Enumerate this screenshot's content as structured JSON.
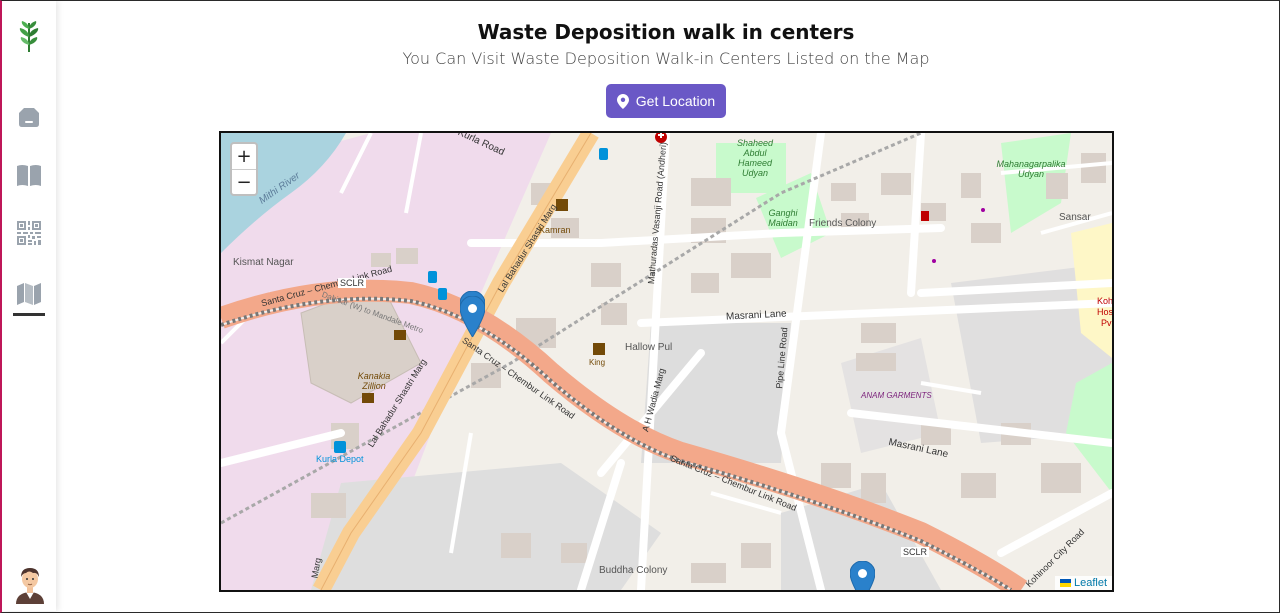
{
  "page": {
    "title": "Waste Deposition walk in centers",
    "subtitle": "You Can Visit Waste Deposition Walk-in Centers Listed on the Map",
    "get_location_label": "Get Location"
  },
  "sidebar": {
    "items": [
      {
        "name": "logo",
        "icon": "leaf-logo-icon"
      },
      {
        "name": "dashboard",
        "icon": "dashboard-icon"
      },
      {
        "name": "guide",
        "icon": "book-icon"
      },
      {
        "name": "qr-scan",
        "icon": "qr-code-icon"
      },
      {
        "name": "map",
        "icon": "map-icon",
        "active": true
      }
    ],
    "avatar": "user-avatar"
  },
  "map": {
    "zoom_in": "+",
    "zoom_out": "−",
    "attribution": "Leaflet",
    "labels": {
      "kurla_road": "Kurla Road",
      "mithi_river": "Mithi River",
      "kismat_nagar": "Kismat Nagar",
      "link_road_1": "Santa Cruz – Chembur Link Road",
      "link_road_2": "Santa Cruz – Chembur Link Road",
      "link_road_3": "Santa Cruz – Chembur Link Road",
      "sclr_1": "SCLR",
      "sclr_2": "SCLR",
      "dahisar": "Dahisar (W) to Mandale Metro",
      "lbs_marg_1": "Lal Bahadur Shastri Marg",
      "lbs_marg_2": "Lal Bahadur Shastri Marg",
      "lbs_marg_3": "Marg",
      "kamran": "Kamran",
      "kanakia": "Kanakia Zillion",
      "kurla_depot": "Kurla Depot",
      "shaheed_park": "Shaheed Abdul Hameed Udyan",
      "ganghi_maidan": "Ganghi Maidan",
      "friends_colony": "Friends Colony",
      "mahanagar": "Mahanagarpalika Udyan",
      "sansar": "Sansar",
      "mathuradas": "Mathuradas Vasanji Road (Andheri)",
      "masrani_lane_1": "Masrani Lane",
      "masrani_lane_2": "Masrani Lane",
      "hallow_pul": "Hallow Pul",
      "king": "King",
      "ah_wadia": "A H Wadia Marg",
      "pipe_line": "Pipe Line Road",
      "anam": "ANAM GARMENTS",
      "kohinoor": "Kohinoor City Road",
      "buddha": "Buddha Colony",
      "hospital_1": "Koh",
      "hospital_2": "Hos",
      "hospital_3": "Pv"
    },
    "markers": [
      {
        "name": "walk-in-center-marker-1"
      },
      {
        "name": "walk-in-center-marker-2"
      },
      {
        "name": "walk-in-center-marker-3"
      }
    ]
  },
  "colors": {
    "accent": "#6a58c6",
    "marker": "#2a81cb",
    "major_road": "#f3b47a",
    "primary_road": "#f9ce92",
    "water": "#aad3df",
    "park": "#c8facc"
  }
}
